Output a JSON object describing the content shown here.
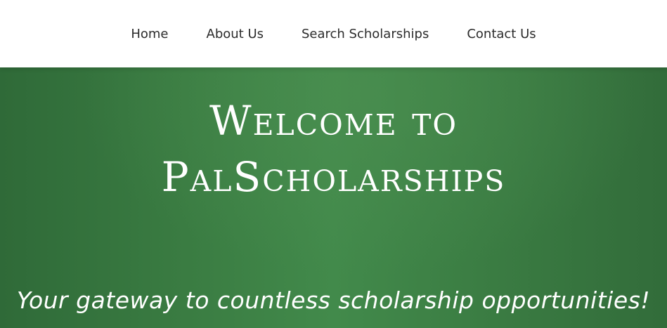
{
  "nav": {
    "items": [
      {
        "label": "Home"
      },
      {
        "label": "About Us"
      },
      {
        "label": "Search Scholarships"
      },
      {
        "label": "Contact Us"
      }
    ]
  },
  "hero": {
    "title_line1": "Welcome to",
    "title_line2": "PalScholarships",
    "subtitle": "Your gateway to countless scholarship opportunities!"
  },
  "colors": {
    "nav_bg": "#ffffff",
    "nav_text": "#2b2b2b",
    "hero_green": "#3a7c42",
    "hero_text": "#ffffff"
  }
}
